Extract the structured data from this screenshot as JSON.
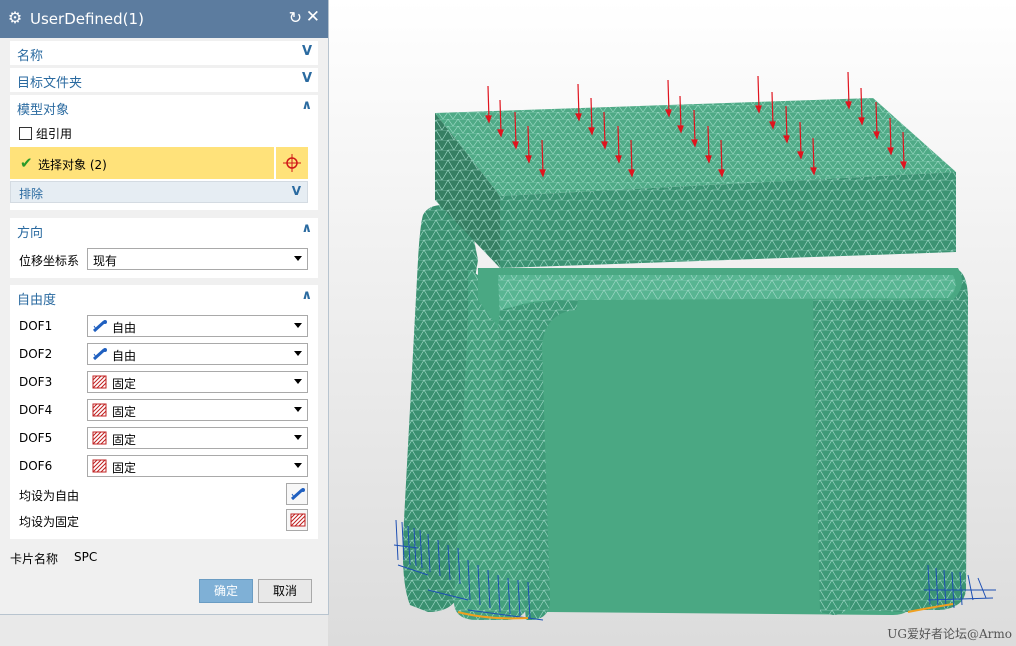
{
  "dialog": {
    "title": "UserDefined(1)",
    "groups": {
      "name": "名称",
      "target_folder": "目标文件夹",
      "model_object": "模型对象",
      "direction": "方向",
      "dof": "自由度"
    },
    "component_ref_label": "组引用",
    "select_object_label": "选择对象 (2)",
    "exclude_label": "排除",
    "displacement_csys_label": "位移坐标系",
    "displacement_csys_value": "现有",
    "dof_rows": [
      {
        "label": "DOF1",
        "value": "自由"
      },
      {
        "label": "DOF2",
        "value": "自由"
      },
      {
        "label": "DOF3",
        "value": "固定"
      },
      {
        "label": "DOF4",
        "value": "固定"
      },
      {
        "label": "DOF5",
        "value": "固定"
      },
      {
        "label": "DOF6",
        "value": "固定"
      }
    ],
    "set_all_free_label": "均设为自由",
    "set_all_fixed_label": "均设为固定",
    "card_name_label": "卡片名称",
    "card_name_value": "SPC",
    "ok_label": "确定",
    "cancel_label": "取消"
  },
  "watermark": "UG爱好者论坛@Armo",
  "colors": {
    "title_bar": "#5c7c9f",
    "group_heading": "#2a6aa0",
    "selection_highlight": "#ffe27a",
    "ok_button": "#7fb0d6",
    "mesh_fill": "#3f9a78",
    "mesh_lines": "#9fd8c6",
    "load_arrows": "#e0141e",
    "constraints": "#1d4fb3"
  }
}
